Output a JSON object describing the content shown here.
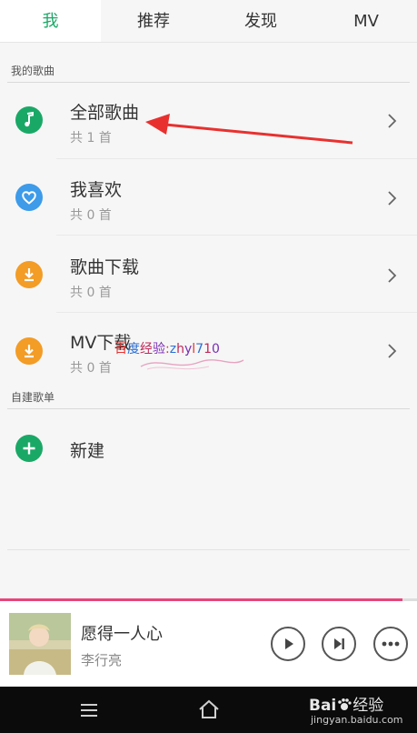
{
  "tabs": [
    "我",
    "推荐",
    "发现",
    "MV"
  ],
  "sections": {
    "my_songs": "我的歌曲",
    "custom_lists": "自建歌单"
  },
  "rows": [
    {
      "title": "全部歌曲",
      "sub": "共 1 首",
      "icon": "music-note-icon",
      "color": "#1aa867"
    },
    {
      "title": "我喜欢",
      "sub": "共 0 首",
      "icon": "heart-icon",
      "color": "#3d9be9"
    },
    {
      "title": "歌曲下载",
      "sub": "共 0 首",
      "icon": "download-icon",
      "color": "#f39c26"
    },
    {
      "title": "MV下载",
      "sub": "共 0 首",
      "icon": "download-icon",
      "color": "#f39c26"
    }
  ],
  "new_list": {
    "label": "新建",
    "icon": "plus-icon",
    "color": "#1aa867"
  },
  "player": {
    "title": "愿得一人心",
    "artist": "李行亮",
    "progress": 0.965
  },
  "watermark": {
    "baidu_jingyan": "百度经验:zhyl710",
    "baidu_logo": "Bai",
    "baidu_du": "经验",
    "site": "jingyan.baidu.com"
  },
  "colors": {
    "accent_green": "#1aa867",
    "accent_pink": "#e8447a",
    "annotation_red": "#e8312f"
  }
}
